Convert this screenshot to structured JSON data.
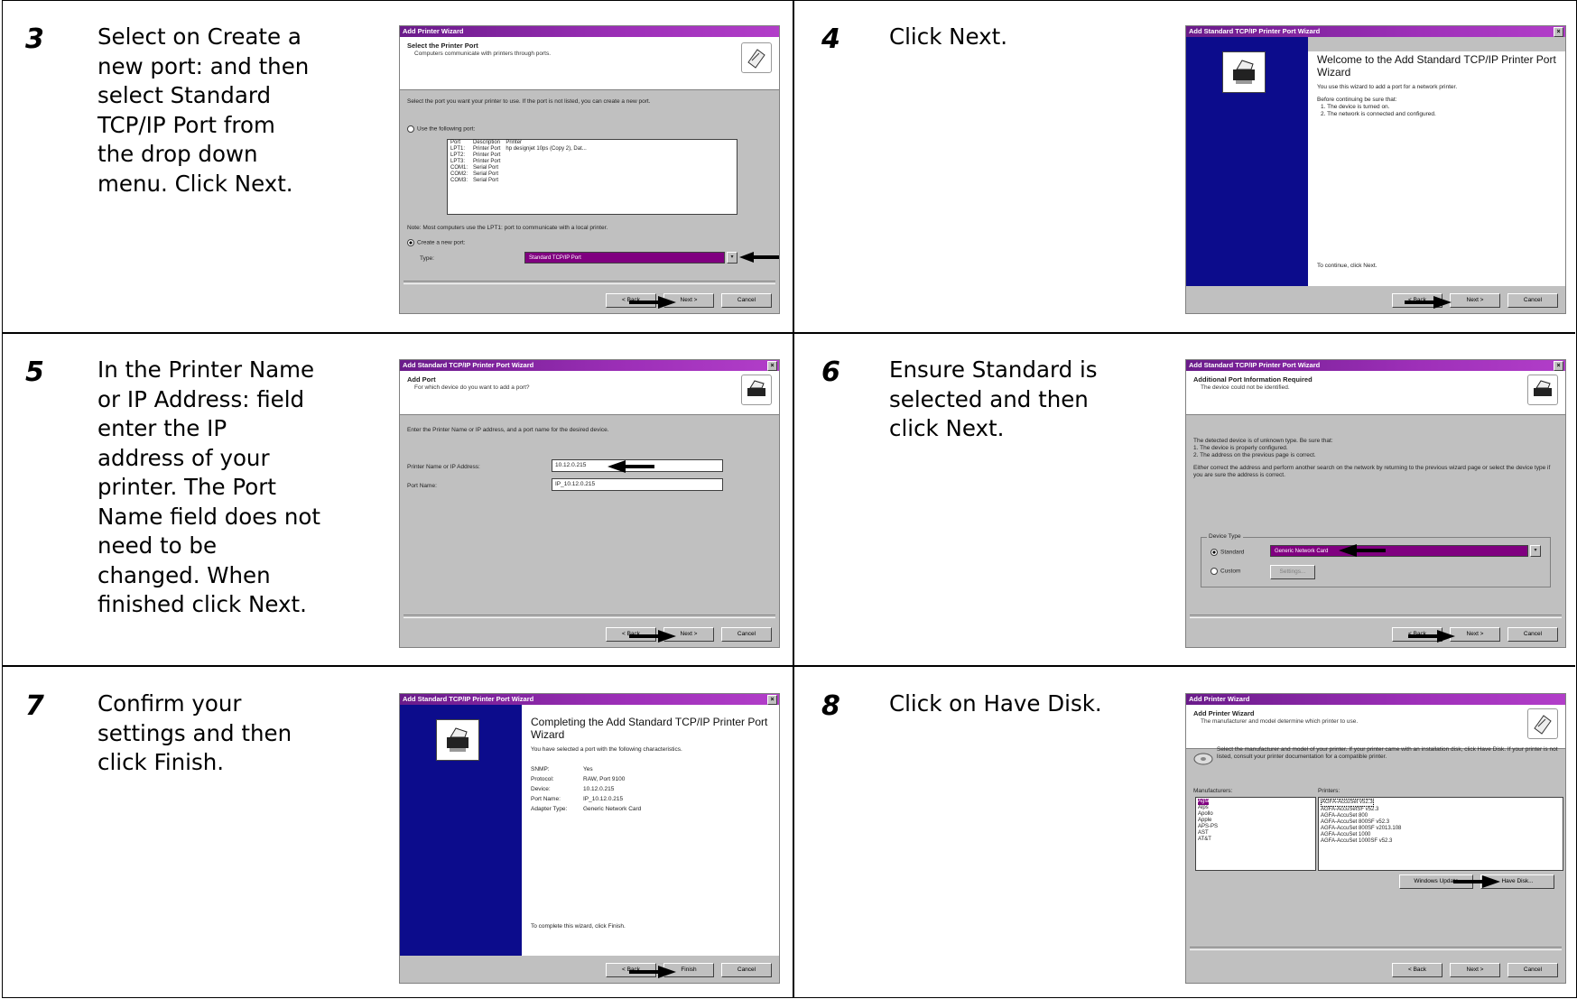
{
  "steps": [
    {
      "number": "3",
      "text": "Select on Create a\nnew port: and then\nselect Standard\nTCP/IP Port from\nthe drop down\nmenu. Click Next."
    },
    {
      "number": "4",
      "text": "Click Next."
    },
    {
      "number": "5",
      "text": "In the Printer Name\nor IP Address: field\nenter the IP\naddress of your\nprinter. The Port\nName field does not\nneed to be\nchanged. When\nfinished click Next."
    },
    {
      "number": "6",
      "text": "Ensure Standard is\nselected and then\nclick Next."
    },
    {
      "number": "7",
      "text": "Confirm your\nsettings and then\nclick Finish."
    },
    {
      "number": "8",
      "text": "Click on Have Disk."
    }
  ],
  "dialogs": {
    "d3": {
      "title": "Add Printer Wizard",
      "header": "Select the Printer Port",
      "subheader": "Computers communicate with printers through ports.",
      "instruction": "Select the port you want your printer to use. If the port is not listed, you can create a new port.",
      "radio_existing": "Use the following port:",
      "columns": [
        "Port",
        "Description",
        "Printer"
      ],
      "rows": [
        [
          "LPT1:",
          "Printer Port",
          "hp designjet 10ps (Copy 2), Dat..."
        ],
        [
          "LPT2:",
          "Printer Port",
          ""
        ],
        [
          "LPT3:",
          "Printer Port",
          ""
        ],
        [
          "COM1:",
          "Serial Port",
          ""
        ],
        [
          "COM2:",
          "Serial Port",
          ""
        ],
        [
          "COM3:",
          "Serial Port",
          ""
        ]
      ],
      "note": "Note: Most computers use the LPT1: port to communicate with a local printer.",
      "radio_create": "Create a new port:",
      "type_label": "Type:",
      "type_value": "Standard TCP/IP Port",
      "back": "< Back",
      "next": "Next >",
      "cancel": "Cancel"
    },
    "d4": {
      "title": "Add Standard TCP/IP Printer Port Wizard",
      "heading": "Welcome to the Add Standard TCP/IP Printer Port Wizard",
      "p1": "You use this wizard to add a port for a network printer.",
      "p2": "Before continuing be sure that:",
      "l1": "1.  The device is turned on.",
      "l2": "2.  The network is connected and configured.",
      "cont": "To continue, click Next.",
      "back": "< Back",
      "next": "Next >",
      "cancel": "Cancel"
    },
    "d5": {
      "title": "Add Standard TCP/IP Printer Port Wizard",
      "header": "Add Port",
      "subheader": "For which device do you want to add a port?",
      "instruction": "Enter the Printer Name or IP address, and a port name for the desired device.",
      "ip_label": "Printer Name or IP Address:",
      "ip_value": "10.12.0.215",
      "port_label": "Port Name:",
      "port_value": "IP_10.12.0.215",
      "back": "< Back",
      "next": "Next >",
      "cancel": "Cancel"
    },
    "d6": {
      "title": "Add Standard TCP/IP Printer Port Wizard",
      "header": "Additional Port Information Required",
      "subheader": "The device could not be identified.",
      "p1": "The detected device is of unknown type. Be sure that:",
      "l1": "1. The device is properly configured.",
      "l2": "2. The address on the previous page is correct.",
      "p2": "Either correct the address and perform another search on the network by returning to the previous wizard page or select the device type if you are sure the address is correct.",
      "group": "Device Type",
      "standard": "Standard",
      "standard_value": "Generic Network Card",
      "custom": "Custom",
      "settings": "Settings...",
      "back": "< Back",
      "next": "Next >",
      "cancel": "Cancel"
    },
    "d7": {
      "title": "Add Standard TCP/IP Printer Port Wizard",
      "heading": "Completing the Add Standard TCP/IP Printer Port Wizard",
      "p1": "You have selected a port with the following characteristics.",
      "kv": [
        [
          "SNMP:",
          "Yes"
        ],
        [
          "Protocol:",
          "RAW, Port 9100"
        ],
        [
          "Device:",
          "10.12.0.215"
        ],
        [
          "Port Name:",
          "IP_10.12.0.215"
        ],
        [
          "Adapter Type:",
          "Generic Network Card"
        ]
      ],
      "finish_text": "To complete this wizard, click Finish.",
      "back": "< Back",
      "finish": "Finish",
      "cancel": "Cancel"
    },
    "d8": {
      "title": "Add Printer Wizard",
      "header": "Add Printer Wizard",
      "subheader": "The manufacturer and model determine which printer to use.",
      "instruction": "Select the manufacturer and model of your printer. If your printer came with an installation disk, click Have Disk. If your printer is not listed, consult your printer documentation for a compatible printer.",
      "mfr_label": "Manufacturers:",
      "mfr": [
        "Agfa",
        "Alps",
        "Apollo",
        "Apple",
        "APS-PS",
        "AST",
        "AT&T"
      ],
      "prn_label": "Printers:",
      "prn": [
        "AGFA-AccuSet v52.3",
        "AGFA-AccuSetSF v52.3",
        "AGFA-AccuSet 800",
        "AGFA-AccuSet 800SF v52.3",
        "AGFA-AccuSet 800SF v2013.108",
        "AGFA-AccuSet 1000",
        "AGFA-AccuSet 1000SF v52.3"
      ],
      "wu": "Windows Update",
      "have_disk": "Have Disk...",
      "back": "< Back",
      "next": "Next >",
      "cancel": "Cancel"
    }
  }
}
